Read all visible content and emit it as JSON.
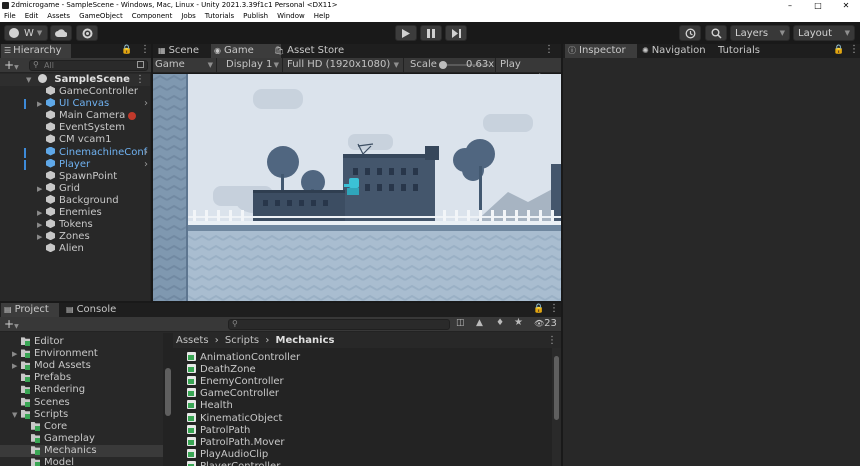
{
  "window": {
    "title": "2dmicrogame - SampleScene - Windows, Mac, Linux - Unity 2021.3.39f1c1 Personal <DX11>",
    "controls": [
      "–",
      "□",
      "✕"
    ]
  },
  "menu": [
    "File",
    "Edit",
    "Assets",
    "GameObject",
    "Component",
    "Jobs",
    "Tutorials",
    "Publish",
    "Window",
    "Help"
  ],
  "toolbar": {
    "account_label": "W",
    "layers_label": "Layers",
    "layout_label": "Layout"
  },
  "hierarchy": {
    "tab_label": "Hierarchy",
    "search_placeholder": "All",
    "scene_name": "SampleScene",
    "items": [
      {
        "label": "GameController",
        "prefab": false,
        "expandable": false
      },
      {
        "label": "UI Canvas",
        "prefab": true,
        "expandable": true
      },
      {
        "label": "Main Camera",
        "prefab": false,
        "expandable": false
      },
      {
        "label": "EventSystem",
        "prefab": false,
        "expandable": false
      },
      {
        "label": "CM vcam1",
        "prefab": false,
        "expandable": false
      },
      {
        "label": "CinemachineConf",
        "prefab": true,
        "expandable": false
      },
      {
        "label": "Player",
        "prefab": true,
        "expandable": false
      },
      {
        "label": "SpawnPoint",
        "prefab": false,
        "expandable": false
      },
      {
        "label": "Grid",
        "prefab": false,
        "expandable": true
      },
      {
        "label": "Background",
        "prefab": false,
        "expandable": false
      },
      {
        "label": "Enemies",
        "prefab": false,
        "expandable": true
      },
      {
        "label": "Tokens",
        "prefab": false,
        "expandable": true
      },
      {
        "label": "Zones",
        "prefab": false,
        "expandable": true
      },
      {
        "label": "Alien",
        "prefab": false,
        "expandable": false
      }
    ]
  },
  "center_tabs": {
    "scene": "Scene",
    "game": "Game",
    "asset_store": "Asset Store"
  },
  "game_bar": {
    "view_mode": "Game",
    "display": "Display 1",
    "resolution": "Full HD (1920x1080)",
    "scale_label": "Scale",
    "scale_value": 0.63,
    "scale_text": "0.63x",
    "play_focused": "Play Focused"
  },
  "inspector": {
    "tab_inspector": "Inspector",
    "tab_navigation": "Navigation",
    "tab_tutorials": "Tutorials"
  },
  "project": {
    "tab_project": "Project",
    "tab_console": "Console",
    "hidden_count": "23",
    "breadcrumb": [
      "Assets",
      "Scripts",
      "Mechanics"
    ],
    "folders": [
      {
        "label": "Editor",
        "indent": 1,
        "expanded": false,
        "has_arrow": false,
        "selected": false
      },
      {
        "label": "Environment",
        "indent": 1,
        "expanded": false,
        "has_arrow": true,
        "selected": false
      },
      {
        "label": "Mod Assets",
        "indent": 1,
        "expanded": false,
        "has_arrow": true,
        "selected": false
      },
      {
        "label": "Prefabs",
        "indent": 1,
        "expanded": false,
        "has_arrow": false,
        "selected": false
      },
      {
        "label": "Rendering",
        "indent": 1,
        "expanded": false,
        "has_arrow": false,
        "selected": false
      },
      {
        "label": "Scenes",
        "indent": 1,
        "expanded": false,
        "has_arrow": false,
        "selected": false
      },
      {
        "label": "Scripts",
        "indent": 1,
        "expanded": true,
        "has_arrow": true,
        "selected": false
      },
      {
        "label": "Core",
        "indent": 2,
        "expanded": false,
        "has_arrow": false,
        "selected": false
      },
      {
        "label": "Gameplay",
        "indent": 2,
        "expanded": false,
        "has_arrow": false,
        "selected": false
      },
      {
        "label": "Mechanics",
        "indent": 2,
        "expanded": false,
        "has_arrow": false,
        "selected": true
      },
      {
        "label": "Model",
        "indent": 2,
        "expanded": false,
        "has_arrow": false,
        "selected": false
      }
    ],
    "files": [
      "AnimationController",
      "DeathZone",
      "EnemyController",
      "GameController",
      "Health",
      "KinematicObject",
      "PatrolPath",
      "PatrolPath.Mover",
      "PlayAudioClip",
      "PlayerController"
    ]
  },
  "colors": {
    "prefab_blue": "#6fb1f0",
    "selection": "#3a3a3a",
    "cs_icon_green": "#3aa655",
    "game_sky": "#d9e2ec"
  }
}
